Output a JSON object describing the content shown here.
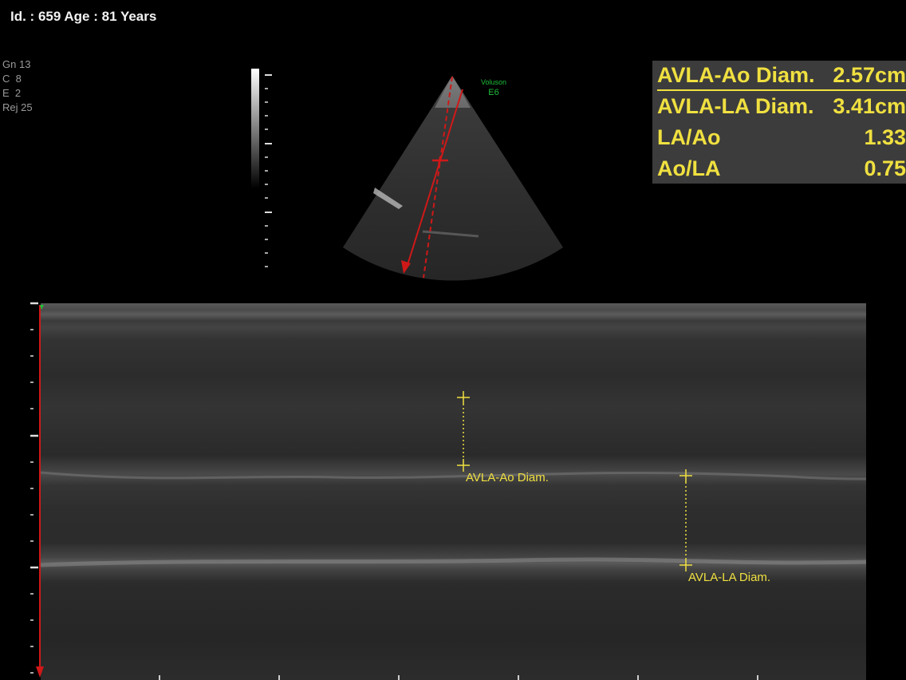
{
  "patient": {
    "header": "Id. : 659 Age : 81 Years"
  },
  "params": [
    {
      "label": "Gn",
      "value": "13"
    },
    {
      "label": "C",
      "value": "8"
    },
    {
      "label": "E",
      "value": "2"
    },
    {
      "label": "Rej",
      "value": "25"
    }
  ],
  "device": {
    "name": "Voluson",
    "model": "E6"
  },
  "measurements": [
    {
      "label": "AVLA-Ao Diam.",
      "value": "2.57cm"
    },
    {
      "label": "AVLA-LA Diam.",
      "value": "3.41cm"
    },
    {
      "label": "LA/Ao",
      "value": "1.33"
    },
    {
      "label": "Ao/LA",
      "value": "0.75"
    }
  ],
  "calipers": {
    "ao_label": "AVLA-Ao Diam.",
    "la_label": "AVLA-LA Diam."
  },
  "colors": {
    "measurement_text": "#f0e040",
    "cursor_line": "#d01818",
    "device_label": "#1fbf3a",
    "panel_background": "#3c3c3c"
  }
}
